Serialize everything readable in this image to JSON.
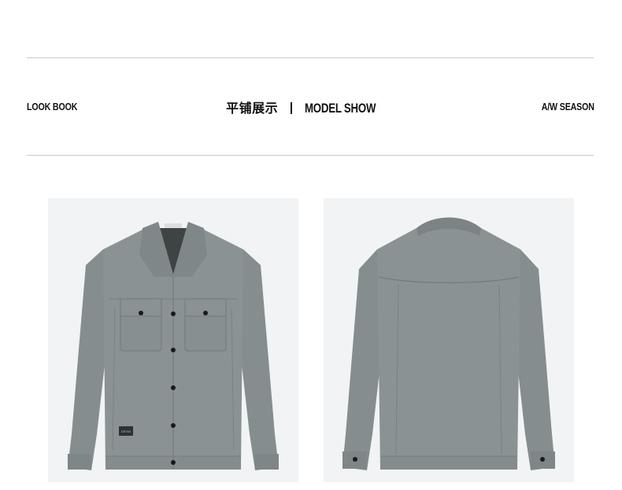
{
  "header": {
    "left_label": "LOOK BOOK",
    "center_cn": "平铺展示",
    "center_en": "MODEL SHOW",
    "right_label": "A/W SEASON"
  },
  "images": {
    "front": {
      "alt": "jacket-front-view",
      "patch_text": "DEVIN"
    },
    "back": {
      "alt": "jacket-back-view"
    }
  },
  "colors": {
    "jacket": "#8a9293",
    "jacket_dark": "#6f7778",
    "panel_bg": "#f1f3f5",
    "rule": "#c9c9c9"
  }
}
